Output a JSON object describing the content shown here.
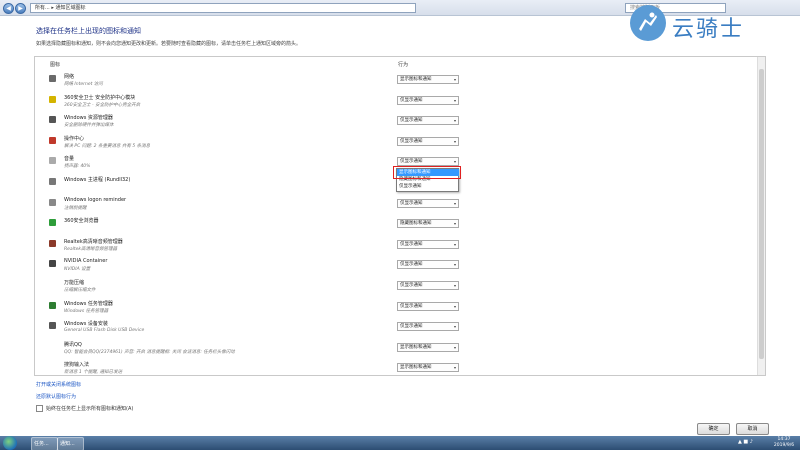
{
  "window": {
    "address": "所有... ▸ 通知区域图标",
    "search_placeholder": "搜索控制面板"
  },
  "watermark": {
    "text": "云骑士"
  },
  "header": {
    "title": "选择在任务栏上出现的图标和通知",
    "description": "如果选择隐藏图标和通知，则不会向您通知更改和更新。若要随时查看隐藏的图标，请单击任务栏上通知区域旁的箭头。"
  },
  "columns": {
    "icon": "图标",
    "behavior": "行为"
  },
  "rows": [
    {
      "name": "网络",
      "sub": "网络 Internet 访问",
      "value": "显示图标和通知",
      "color": "#6a6a6a"
    },
    {
      "name": "360安全卫士 安全防护中心模块",
      "sub": "360安全卫士 - 安全防护中心完全开启",
      "value": "仅显示通知",
      "color": "#d4b400"
    },
    {
      "name": "Windows 资源管理器",
      "sub": "安全删除硬件并弹出媒体",
      "value": "仅显示通知",
      "color": "#555555"
    },
    {
      "name": "操作中心",
      "sub": "解决 PC 问题: 2 条重要消息 共有 5 条消息",
      "value": "仅显示通知",
      "color": "#c0392b"
    },
    {
      "name": "音量",
      "sub": "扬声器: 40%",
      "value": "仅显示通知",
      "color": "#aaaaaa"
    },
    {
      "name": "Windows 主进程 (Rundll32)",
      "sub": "",
      "value": "仅显示通知",
      "color": "#777777"
    },
    {
      "name": "Windows logon reminder",
      "sub": "注销前提醒",
      "value": "仅显示通知",
      "color": "#888888"
    },
    {
      "name": "360安全浏览器",
      "sub": "",
      "value": "隐藏图标和通知",
      "color": "#2e9d3a"
    },
    {
      "name": "Realtek高清晰音频管理器",
      "sub": "Realtek高清晰音频管理器",
      "value": "仅显示通知",
      "color": "#8b3a2a"
    },
    {
      "name": "NVIDIA Container",
      "sub": "NVIDIA 设置",
      "value": "仅显示通知",
      "color": "#444444"
    },
    {
      "name": "万能压缩",
      "sub": "压缩解压缩文件",
      "value": "仅显示通知",
      "color": "#ffffff"
    },
    {
      "name": "Windows 任务管理器",
      "sub": "Windows 任务管理器",
      "value": "仅显示通知",
      "color": "#2e7d32"
    },
    {
      "name": "Windows 设备安装",
      "sub": "General USB Flash Disk USB Device",
      "value": "仅显示通知",
      "color": "#555555"
    },
    {
      "name": "腾讯QQ",
      "sub": "QQ: 智能会员QQ(2374961)  声音: 开启  消息提醒框: 关闭  会话消息: 任务栏头像闪动",
      "value": "显示图标和通知",
      "color": "#ffffff"
    },
    {
      "name": "搜狗输入法",
      "sub": "新消息 1 个提醒, 通知已发送",
      "value": "显示图标和通知",
      "color": "#ffffff"
    }
  ],
  "dropdown": {
    "options": [
      "显示图标和通知",
      "隐藏图标和通知",
      "仅显示通知"
    ],
    "selected_index": 0,
    "highlight_color": "#3399ff"
  },
  "links": {
    "system_icons": "打开或关闭系统图标",
    "restore_defaults": "还原默认图标行为"
  },
  "always_show": "始终在任务栏上显示所有图标和通知(A)",
  "buttons": {
    "ok": "确定",
    "cancel": "取消"
  },
  "taskbar": {
    "tasks": [
      "任务...",
      "通知..."
    ],
    "time": "14:37",
    "date": "2019/9/6"
  }
}
